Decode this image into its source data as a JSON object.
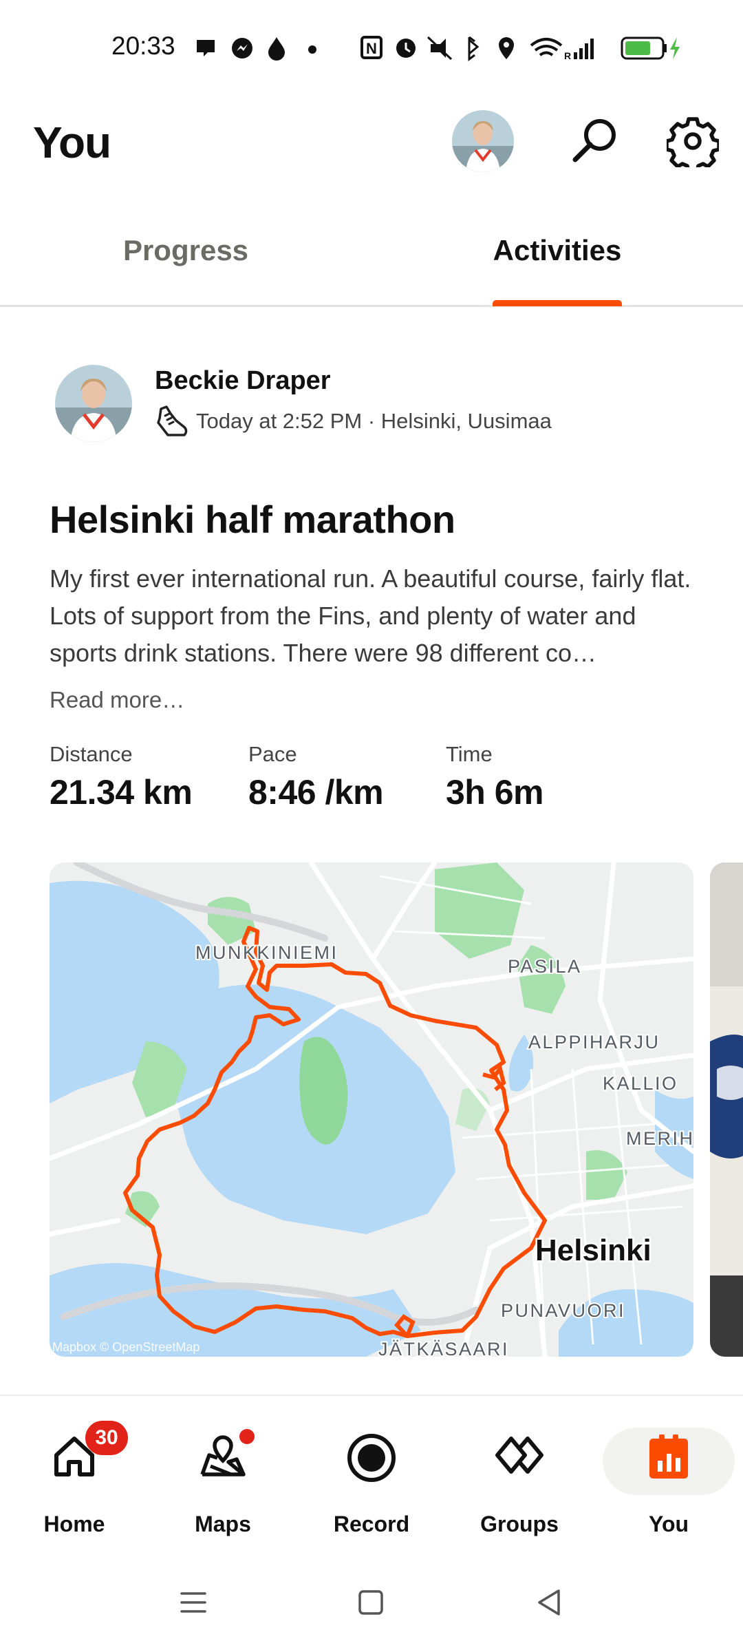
{
  "status_bar": {
    "time": "20:33"
  },
  "header": {
    "title": "You"
  },
  "tabs": [
    {
      "label": "Progress",
      "active": false
    },
    {
      "label": "Activities",
      "active": true
    }
  ],
  "activity": {
    "athlete_name": "Beckie Draper",
    "meta": "Today at 2:52 PM · Helsinki, Uusimaa",
    "title": "Helsinki half marathon",
    "description": "My first ever international run. A beautiful course, fairly flat. Lots of support from the Fins, and plenty of water and sports drink stations. There were 98 different co…",
    "read_more": "Read more…",
    "stats": [
      {
        "label": "Distance",
        "value": "21.34 km"
      },
      {
        "label": "Pace",
        "value": "8:46 /km"
      },
      {
        "label": "Time",
        "value": "3h 6m"
      }
    ]
  },
  "map": {
    "labels": {
      "munkkiniemi": "MUNKKINIEMI",
      "pasila": "PASILA",
      "alppiharju": "ALPPIHARJU",
      "kallio": "KALLIO",
      "meri": "MERIH",
      "helsinki": "Helsinki",
      "punavuori": "PUNAVUORI",
      "jatkasaari": "JÄTKÄSAARI"
    },
    "attribution": "Mapbox © OpenStreetMap",
    "route_color": "#fc4c02"
  },
  "bottom_nav": {
    "items": [
      {
        "label": "Home",
        "badge": "30"
      },
      {
        "label": "Maps"
      },
      {
        "label": "Record"
      },
      {
        "label": "Groups"
      },
      {
        "label": "You",
        "active": true
      }
    ]
  },
  "colors": {
    "accent": "#fc4c02",
    "badge": "#e2231a"
  }
}
